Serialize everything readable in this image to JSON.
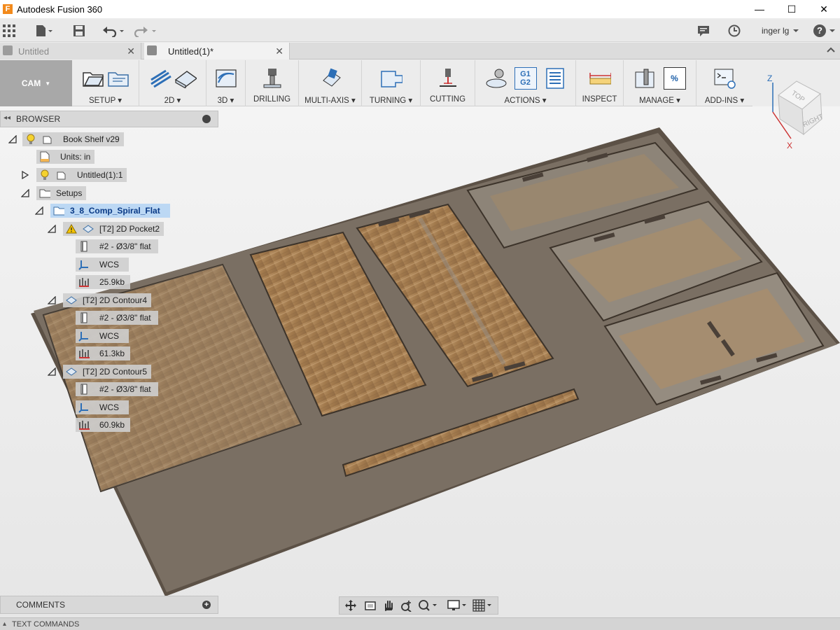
{
  "window": {
    "app_title": "Autodesk Fusion 360",
    "logo_letter": "F",
    "minimize": "—",
    "maximize": "☐",
    "close": "✕"
  },
  "qat": {
    "user": "inger lg",
    "help": "?"
  },
  "tabs": [
    {
      "label": "Untitled",
      "active": false
    },
    {
      "label": "Untitled(1)*",
      "active": true
    }
  ],
  "ribbon": {
    "workspace": "CAM",
    "groups": [
      {
        "label": "SETUP",
        "dropdown": true
      },
      {
        "label": "2D",
        "dropdown": true
      },
      {
        "label": "3D",
        "dropdown": true
      },
      {
        "label": "DRILLING",
        "dropdown": false
      },
      {
        "label": "MULTI-AXIS",
        "dropdown": true
      },
      {
        "label": "TURNING",
        "dropdown": true
      },
      {
        "label": "CUTTING",
        "dropdown": false
      },
      {
        "label": "ACTIONS",
        "dropdown": true
      },
      {
        "label": "INSPECT",
        "dropdown": false
      },
      {
        "label": "MANAGE",
        "dropdown": true
      },
      {
        "label": "ADD-INS",
        "dropdown": true
      }
    ],
    "actions_icon_text": [
      "G1",
      "G2"
    ],
    "manage_icon_text": "%"
  },
  "browser": {
    "title": "BROWSER",
    "tree": {
      "root": "Book Shelf v29",
      "units": "Units: in",
      "component": "Untitled(1):1",
      "setups": "Setups",
      "setup": "3_8_Comp_Spiral_Flat",
      "operations": [
        {
          "name": "[T2] 2D Pocket2",
          "warning": true,
          "tool": "#2 - Ø3/8\" flat",
          "wcs": "WCS",
          "size": "25.9kb"
        },
        {
          "name": "[T2] 2D Contour4",
          "warning": false,
          "tool": "#2 - Ø3/8\" flat",
          "wcs": "WCS",
          "size": "61.3kb"
        },
        {
          "name": "[T2] 2D Contour5",
          "warning": false,
          "tool": "#2 - Ø3/8\" flat",
          "wcs": "WCS",
          "size": "60.9kb"
        }
      ]
    }
  },
  "comments": {
    "title": "COMMENTS"
  },
  "text_commands": {
    "title": "TEXT COMMANDS"
  },
  "viewcube": {
    "top": "TOP",
    "right": "RIGHT",
    "axis_z": "Z",
    "axis_x": "X"
  }
}
